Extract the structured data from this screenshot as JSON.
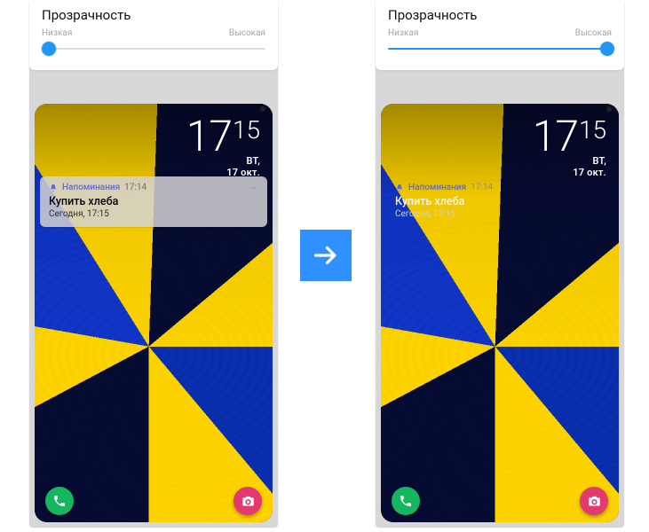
{
  "panel": {
    "title": "Прозрачность",
    "low": "Низкая",
    "high": "Высокая"
  },
  "clock": {
    "hours": "17",
    "minutes": "15",
    "weekday": "ВТ,",
    "date": "17 окт."
  },
  "notification": {
    "app": "Напоминания",
    "time": "17:14",
    "title": "Купить хлеба",
    "line": "Сегодня, 17:15"
  },
  "slider": {
    "left_pct": 3,
    "right_pct": 98
  },
  "colors": {
    "accent": "#2196f3",
    "arrow": "#2f90ff",
    "notif_app": "#5f67e8"
  }
}
